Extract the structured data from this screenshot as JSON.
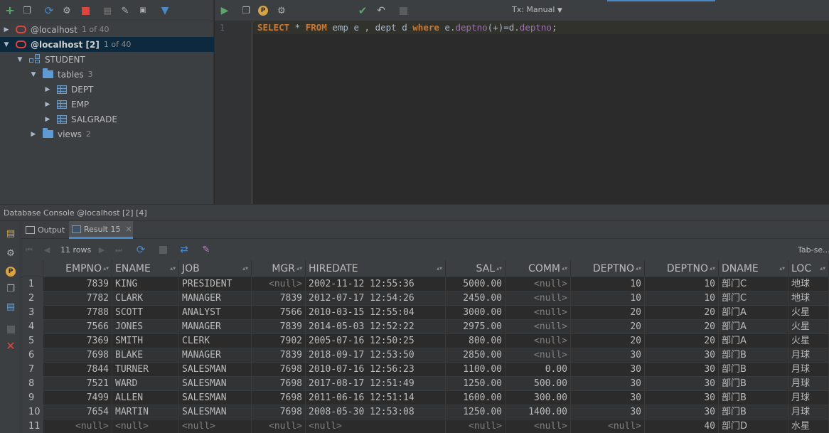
{
  "tree": {
    "connections": [
      {
        "label": "@localhost",
        "count": "1 of 40"
      },
      {
        "label": "@localhost [2]",
        "count": "1 of 40"
      }
    ],
    "schema": "STUDENT",
    "tables_folder": {
      "label": "tables",
      "count": "3"
    },
    "tables": [
      "DEPT",
      "EMP",
      "SALGRADE"
    ],
    "views_folder": {
      "label": "views",
      "count": "2"
    }
  },
  "editor": {
    "tx_mode": "Tx: Manual",
    "line_number": "1"
  },
  "console": {
    "title": "Database Console @localhost [2] [4]",
    "tabs": {
      "output": "Output",
      "result": "Result 15"
    },
    "rows_count": "11 rows",
    "tab_separated": "Tab-se..."
  },
  "grid": {
    "columns": [
      "EMPNO",
      "ENAME",
      "JOB",
      "MGR",
      "HIREDATE",
      "SAL",
      "COMM",
      "DEPTNO",
      "DEPTNO",
      "DNAME",
      "LOC"
    ],
    "rows": [
      [
        "1",
        "7839",
        "KING",
        "PRESIDENT",
        "<null>",
        "2002-11-12 12:55:36",
        "5000.00",
        "<null>",
        "10",
        "10",
        "部门C",
        "地球"
      ],
      [
        "2",
        "7782",
        "CLARK",
        "MANAGER",
        "7839",
        "2012-07-17 12:54:26",
        "2450.00",
        "<null>",
        "10",
        "10",
        "部门C",
        "地球"
      ],
      [
        "3",
        "7788",
        "SCOTT",
        "ANALYST",
        "7566",
        "2010-03-15 12:55:04",
        "3000.00",
        "<null>",
        "20",
        "20",
        "部门A",
        "火星"
      ],
      [
        "4",
        "7566",
        "JONES",
        "MANAGER",
        "7839",
        "2014-05-03 12:52:22",
        "2975.00",
        "<null>",
        "20",
        "20",
        "部门A",
        "火星"
      ],
      [
        "5",
        "7369",
        "SMITH",
        "CLERK",
        "7902",
        "2005-07-16 12:50:25",
        "800.00",
        "<null>",
        "20",
        "20",
        "部门A",
        "火星"
      ],
      [
        "6",
        "7698",
        "BLAKE",
        "MANAGER",
        "7839",
        "2018-09-17 12:53:50",
        "2850.00",
        "<null>",
        "30",
        "30",
        "部门B",
        "月球"
      ],
      [
        "7",
        "7844",
        "TURNER",
        "SALESMAN",
        "7698",
        "2010-07-16 12:56:23",
        "1100.00",
        "0.00",
        "30",
        "30",
        "部门B",
        "月球"
      ],
      [
        "8",
        "7521",
        "WARD",
        "SALESMAN",
        "7698",
        "2017-08-17 12:51:49",
        "1250.00",
        "500.00",
        "30",
        "30",
        "部门B",
        "月球"
      ],
      [
        "9",
        "7499",
        "ALLEN",
        "SALESMAN",
        "7698",
        "2011-06-16 12:51:14",
        "1600.00",
        "300.00",
        "30",
        "30",
        "部门B",
        "月球"
      ],
      [
        "10",
        "7654",
        "MARTIN",
        "SALESMAN",
        "7698",
        "2008-05-30 12:53:08",
        "1250.00",
        "1400.00",
        "30",
        "30",
        "部门B",
        "月球"
      ],
      [
        "11",
        "<null>",
        "<null>",
        "<null>",
        "<null>",
        "<null>",
        "<null>",
        "<null>",
        "<null>",
        "40",
        "部门D",
        "水星"
      ]
    ]
  }
}
